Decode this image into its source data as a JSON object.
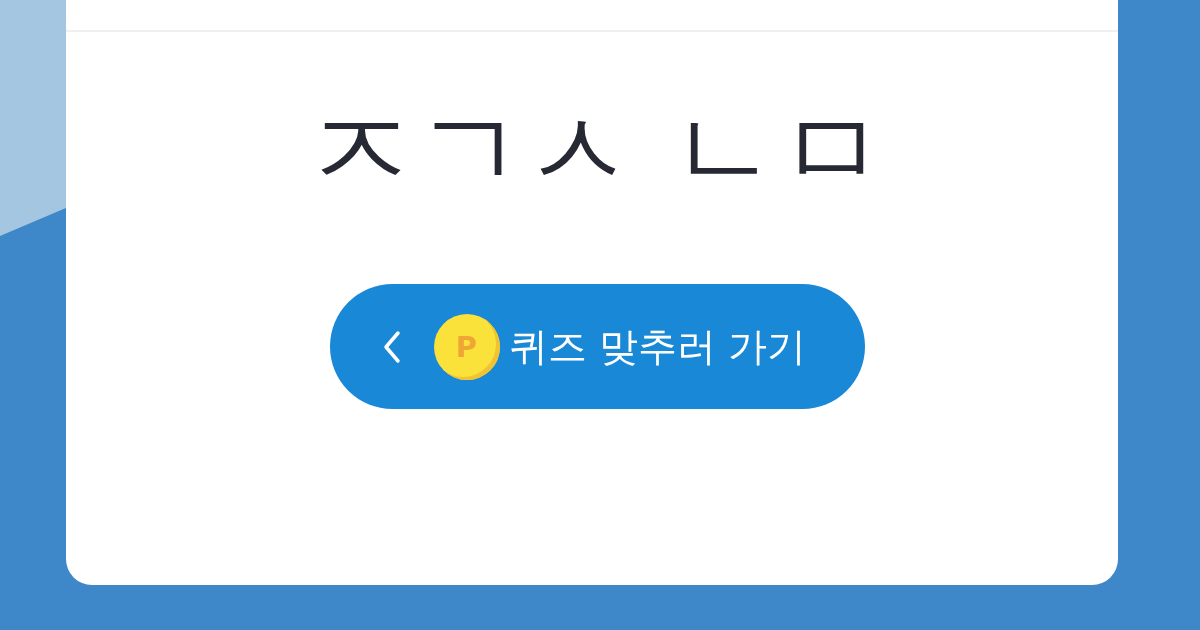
{
  "quiz_card": {
    "hint": "ㅈㄱㅅ ㄴㅁ",
    "button": {
      "label": "퀴즈 맞추러 가기",
      "coin_label": "P"
    }
  }
}
